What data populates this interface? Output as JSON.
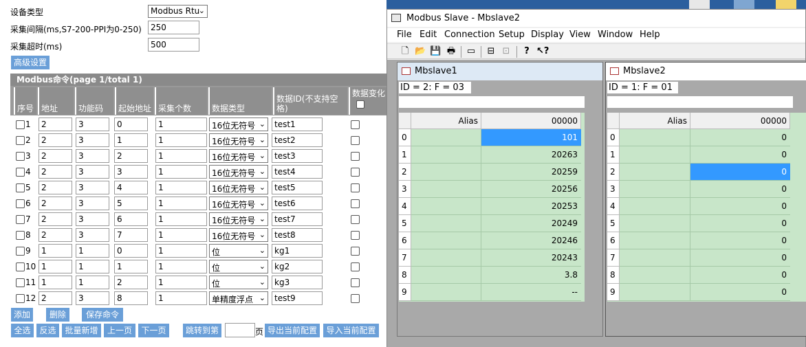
{
  "config": {
    "device_type_label": "设备类型",
    "device_type_value": "Modbus Rtu",
    "interval_label": "采集间隔(ms,S7-200-PPI为0-250)",
    "interval_value": "250",
    "timeout_label": "采集超时(ms)",
    "timeout_value": "500",
    "advanced_button": "高级设置"
  },
  "table": {
    "title": "Modbus命令(page 1/total 1)",
    "headers": {
      "index": "序号",
      "address": "地址",
      "function_code": "功能码",
      "start_address": "起始地址",
      "count": "采集个数",
      "data_type": "数据类型",
      "data_id": "数据ID(不支持空格)",
      "data_change": "数据变化"
    },
    "rows": [
      {
        "idx": "1",
        "address": "2",
        "func": "3",
        "start": "0",
        "count": "1",
        "type": "16位无符号",
        "id": "test1"
      },
      {
        "idx": "2",
        "address": "2",
        "func": "3",
        "start": "1",
        "count": "1",
        "type": "16位无符号",
        "id": "test2"
      },
      {
        "idx": "3",
        "address": "2",
        "func": "3",
        "start": "2",
        "count": "1",
        "type": "16位无符号",
        "id": "test3"
      },
      {
        "idx": "4",
        "address": "2",
        "func": "3",
        "start": "3",
        "count": "1",
        "type": "16位无符号",
        "id": "test4"
      },
      {
        "idx": "5",
        "address": "2",
        "func": "3",
        "start": "4",
        "count": "1",
        "type": "16位无符号",
        "id": "test5"
      },
      {
        "idx": "6",
        "address": "2",
        "func": "3",
        "start": "5",
        "count": "1",
        "type": "16位无符号",
        "id": "test6"
      },
      {
        "idx": "7",
        "address": "2",
        "func": "3",
        "start": "6",
        "count": "1",
        "type": "16位无符号",
        "id": "test7"
      },
      {
        "idx": "8",
        "address": "2",
        "func": "3",
        "start": "7",
        "count": "1",
        "type": "16位无符号",
        "id": "test8"
      },
      {
        "idx": "9",
        "address": "1",
        "func": "1",
        "start": "0",
        "count": "1",
        "type": "位",
        "id": "kg1"
      },
      {
        "idx": "10",
        "address": "1",
        "func": "1",
        "start": "1",
        "count": "1",
        "type": "位",
        "id": "kg2"
      },
      {
        "idx": "11",
        "address": "1",
        "func": "1",
        "start": "2",
        "count": "1",
        "type": "位",
        "id": "kg3"
      },
      {
        "idx": "12",
        "address": "2",
        "func": "3",
        "start": "8",
        "count": "1",
        "type": "单精度浮点",
        "id": "test9"
      }
    ]
  },
  "actions": {
    "add": "添加",
    "delete": "删除",
    "save": "保存命令",
    "select_all": "全选",
    "invert": "反选",
    "batch_add": "批量新增",
    "prev_page": "上一页",
    "next_page": "下一页",
    "goto_page": "跳转到第",
    "page_value": "",
    "page_suffix": "页",
    "export": "导出当前配置",
    "import": "导入当前配置"
  },
  "modbus_window": {
    "title": "Modbus Slave - Mbslave2",
    "menu": [
      "File",
      "Edit",
      "Connection",
      "Setup",
      "Display",
      "View",
      "Window",
      "Help"
    ],
    "toolbar_icons": [
      "new-file-icon",
      "open-folder-icon",
      "save-icon",
      "print-icon",
      "window-icon",
      "display-icon",
      "disabled-icon",
      "help-icon",
      "context-help-icon"
    ],
    "slaves": [
      {
        "title": "Mbslave1",
        "info": "ID = 2: F = 03",
        "alias_header": "Alias",
        "value_header": "00000",
        "rows": [
          "0",
          "1",
          "2",
          "3",
          "4",
          "5",
          "6",
          "7",
          "8",
          "9"
        ],
        "values": [
          "101",
          "20263",
          "20259",
          "20256",
          "20253",
          "20249",
          "20246",
          "20243",
          "3.8",
          "--"
        ],
        "selected_row": 0
      },
      {
        "title": "Mbslave2",
        "info": "ID = 1: F = 01",
        "alias_header": "Alias",
        "value_header": "00000",
        "rows": [
          "0",
          "1",
          "2",
          "3",
          "4",
          "5",
          "6",
          "7",
          "8",
          "9"
        ],
        "values": [
          "0",
          "0",
          "0",
          "0",
          "0",
          "0",
          "0",
          "0",
          "0",
          "0"
        ],
        "selected_row": 2
      }
    ],
    "colors": {
      "grid": "#c8e6c9",
      "selected": "#3399ff",
      "mdi_background": "#a9a9a9"
    }
  }
}
